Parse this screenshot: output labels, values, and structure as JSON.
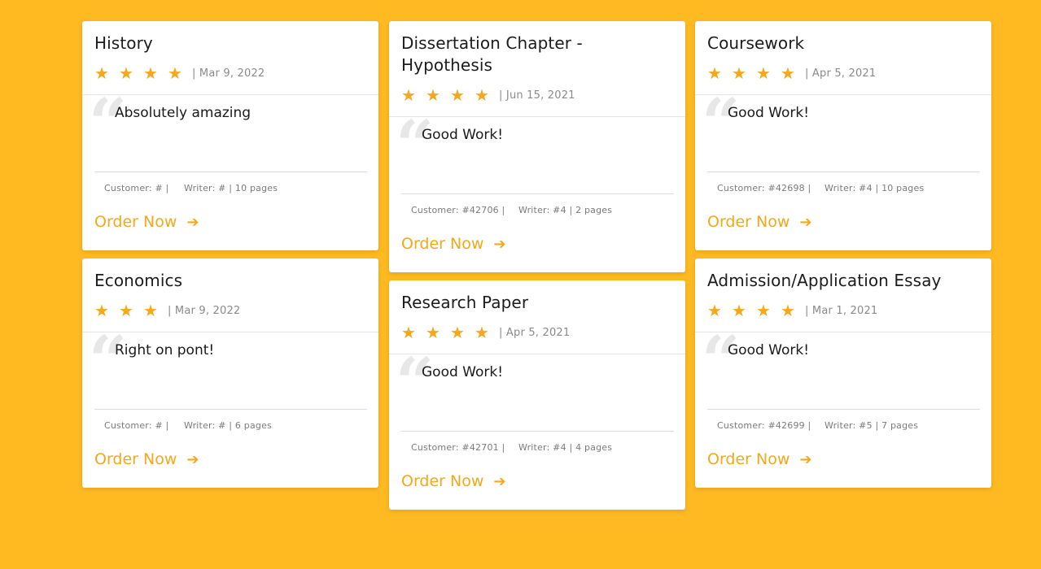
{
  "columns": [
    [
      {
        "title": "History",
        "stars": 4,
        "date": "| Mar 9, 2022",
        "review": "Absolutely amazing",
        "customer": "Customer: # |",
        "writer": "Writer: # | 10 pages",
        "order_label": "Order Now"
      },
      {
        "title": "Economics",
        "stars": 3,
        "date": "| Mar 9, 2022",
        "review": "Right on pont!",
        "customer": "Customer: # |",
        "writer": "Writer: # | 6 pages",
        "order_label": "Order Now"
      }
    ],
    [
      {
        "title": "Dissertation Chapter - Hypothesis",
        "stars": 4,
        "date": "| Jun 15, 2021",
        "review": "Good Work!",
        "customer": "Customer: #42706 |",
        "writer": "Writer: #4 | 2 pages",
        "order_label": "Order Now"
      },
      {
        "title": "Research Paper",
        "stars": 4,
        "date": "| Apr 5, 2021",
        "review": "Good Work!",
        "customer": "Customer: #42701 |",
        "writer": "Writer: #4 | 4 pages",
        "order_label": "Order Now"
      }
    ],
    [
      {
        "title": "Coursework",
        "stars": 4,
        "date": "| Apr 5, 2021",
        "review": "Good Work!",
        "customer": "Customer: #42698 |",
        "writer": "Writer: #4 | 10 pages",
        "order_label": "Order Now"
      },
      {
        "title": "Admission/Application Essay",
        "stars": 4,
        "date": "| Mar 1, 2021",
        "review": "Good Work!",
        "customer": "Customer: #42699 |",
        "writer": "Writer: #5 | 7 pages",
        "order_label": "Order Now"
      }
    ]
  ],
  "icons": {
    "star": "star-icon",
    "quote": "quote-icon",
    "arrow": "arrow-right-icon"
  },
  "colors": {
    "background": "#FFBA22",
    "accent": "#F2A81B",
    "star": "#F4A81A"
  }
}
